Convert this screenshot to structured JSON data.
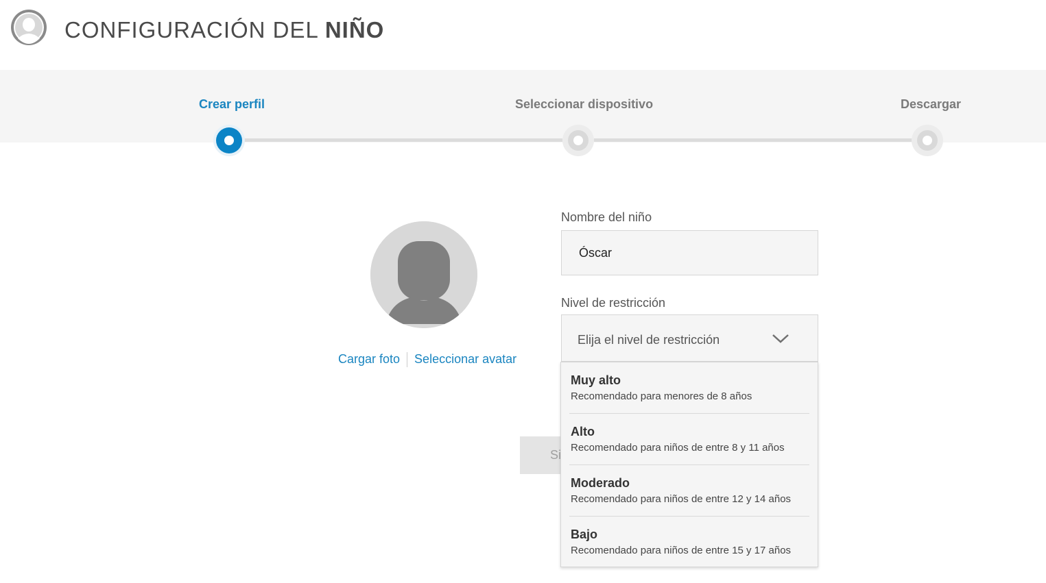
{
  "header": {
    "title_prefix": "CONFIGURACIÓN DEL ",
    "title_bold": "NIÑO",
    "avatar_icon": "user-circle-icon"
  },
  "stepper": {
    "steps": [
      {
        "label": "Crear perfil",
        "state": "active"
      },
      {
        "label": "Seleccionar dispositivo",
        "state": "pending"
      },
      {
        "label": "Descargar",
        "state": "pending"
      }
    ],
    "active_color": "#0b84c6"
  },
  "profile": {
    "avatar_icon": "default-avatar-icon",
    "upload_photo_label": "Cargar foto",
    "select_avatar_label": "Seleccionar avatar"
  },
  "form": {
    "name_label": "Nombre del niño",
    "name_value": "Óscar",
    "restriction_label": "Nivel de restricción",
    "restriction_placeholder": "Elija el nivel de restricción",
    "chevron_icon": "chevron-down-icon"
  },
  "next_button": {
    "visible_text": "Si"
  },
  "dropdown": {
    "options": [
      {
        "title": "Muy alto",
        "description": "Recomendado para menores de 8 años"
      },
      {
        "title": "Alto",
        "description": "Recomendado para niños de entre 8 y 11 años"
      },
      {
        "title": "Moderado",
        "description": "Recomendado para niños de entre 12 y 14 años"
      },
      {
        "title": "Bajo",
        "description": "Recomendado para niños de entre 15 y 17 años"
      }
    ]
  },
  "colors": {
    "link": "#1a85c0",
    "band_background": "#f5f5f5"
  }
}
